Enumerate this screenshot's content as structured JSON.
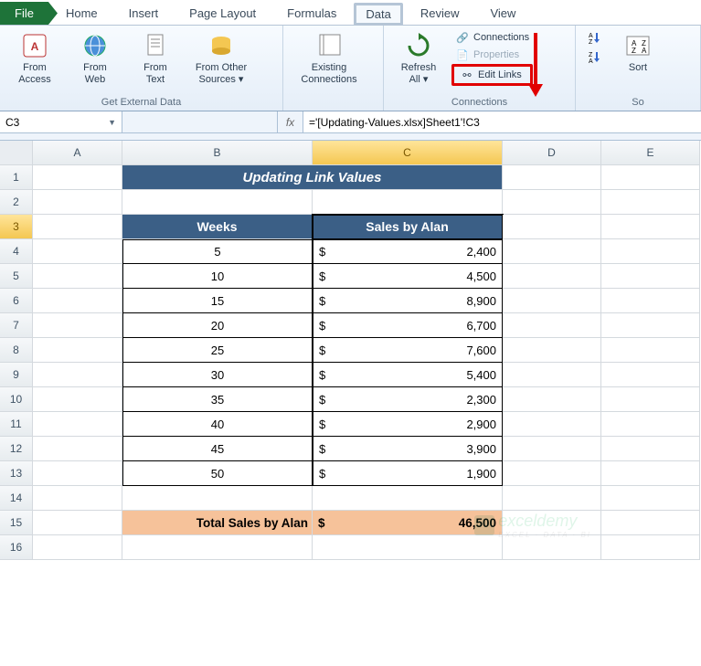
{
  "tabs": {
    "file": "File",
    "home": "Home",
    "insert": "Insert",
    "pagelayout": "Page Layout",
    "formulas": "Formulas",
    "data": "Data",
    "review": "Review",
    "view": "View"
  },
  "ribbon": {
    "ext": {
      "access": "From\nAccess",
      "web": "From\nWeb",
      "text": "From\nText",
      "other": "From Other\nSources ▾",
      "existing": "Existing\nConnections",
      "group": "Get External Data"
    },
    "conn": {
      "refresh": "Refresh\nAll ▾",
      "connections": "Connections",
      "properties": "Properties",
      "editlinks": "Edit Links",
      "group": "Connections"
    },
    "sort": {
      "sort": "Sort",
      "group": "So"
    }
  },
  "namebox": "C3",
  "formula": "='[Updating-Values.xlsx]Sheet1'!C3",
  "cols": [
    "A",
    "B",
    "C",
    "D",
    "E"
  ],
  "title": "Updating Link Values",
  "headers": {
    "b": "Weeks",
    "c": "Sales by Alan"
  },
  "rows": [
    {
      "w": "5",
      "s": "2,400"
    },
    {
      "w": "10",
      "s": "4,500"
    },
    {
      "w": "15",
      "s": "8,900"
    },
    {
      "w": "20",
      "s": "6,700"
    },
    {
      "w": "25",
      "s": "7,600"
    },
    {
      "w": "30",
      "s": "5,400"
    },
    {
      "w": "35",
      "s": "2,300"
    },
    {
      "w": "40",
      "s": "2,900"
    },
    {
      "w": "45",
      "s": "3,900"
    },
    {
      "w": "50",
      "s": "1,900"
    }
  ],
  "total": {
    "label": "Total Sales by Alan",
    "value": "46,500"
  },
  "currency": "$",
  "watermark": {
    "brand": "exceldemy",
    "tag": "EXCEL · DATA · BI"
  },
  "chart_data": {
    "type": "table",
    "title": "Updating Link Values",
    "columns": [
      "Weeks",
      "Sales by Alan"
    ],
    "rows": [
      [
        5,
        2400
      ],
      [
        10,
        4500
      ],
      [
        15,
        8900
      ],
      [
        20,
        6700
      ],
      [
        25,
        7600
      ],
      [
        30,
        5400
      ],
      [
        35,
        2300
      ],
      [
        40,
        2900
      ],
      [
        45,
        3900
      ],
      [
        50,
        1900
      ]
    ],
    "aggregate": {
      "label": "Total Sales by Alan",
      "value": 46500
    }
  }
}
